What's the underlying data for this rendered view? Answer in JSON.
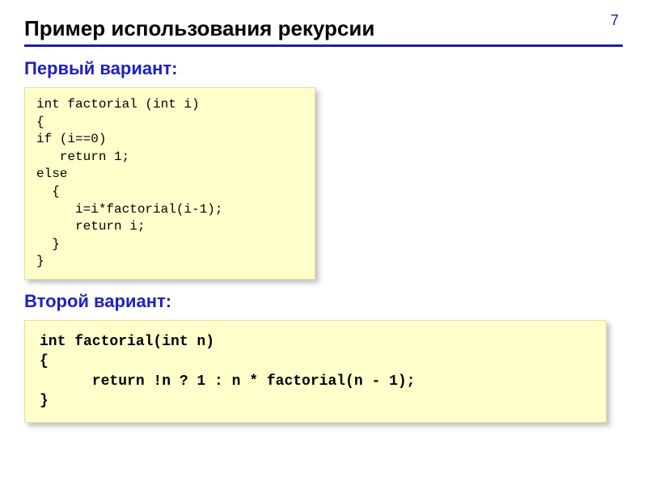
{
  "page_number": "7",
  "slide_title": "Пример использования рекурсии",
  "section1": {
    "heading": "Первый вариант:",
    "code": "int factorial (int i)\n{\nif (i==0)\n   return 1;\nelse\n  {\n     i=i*factorial(i-1);\n     return i;\n  }\n}"
  },
  "section2": {
    "heading": "Второй вариант:",
    "code": "int factorial(int n)\n{\n      return !n ? 1 : n * factorial(n - 1);\n}"
  }
}
